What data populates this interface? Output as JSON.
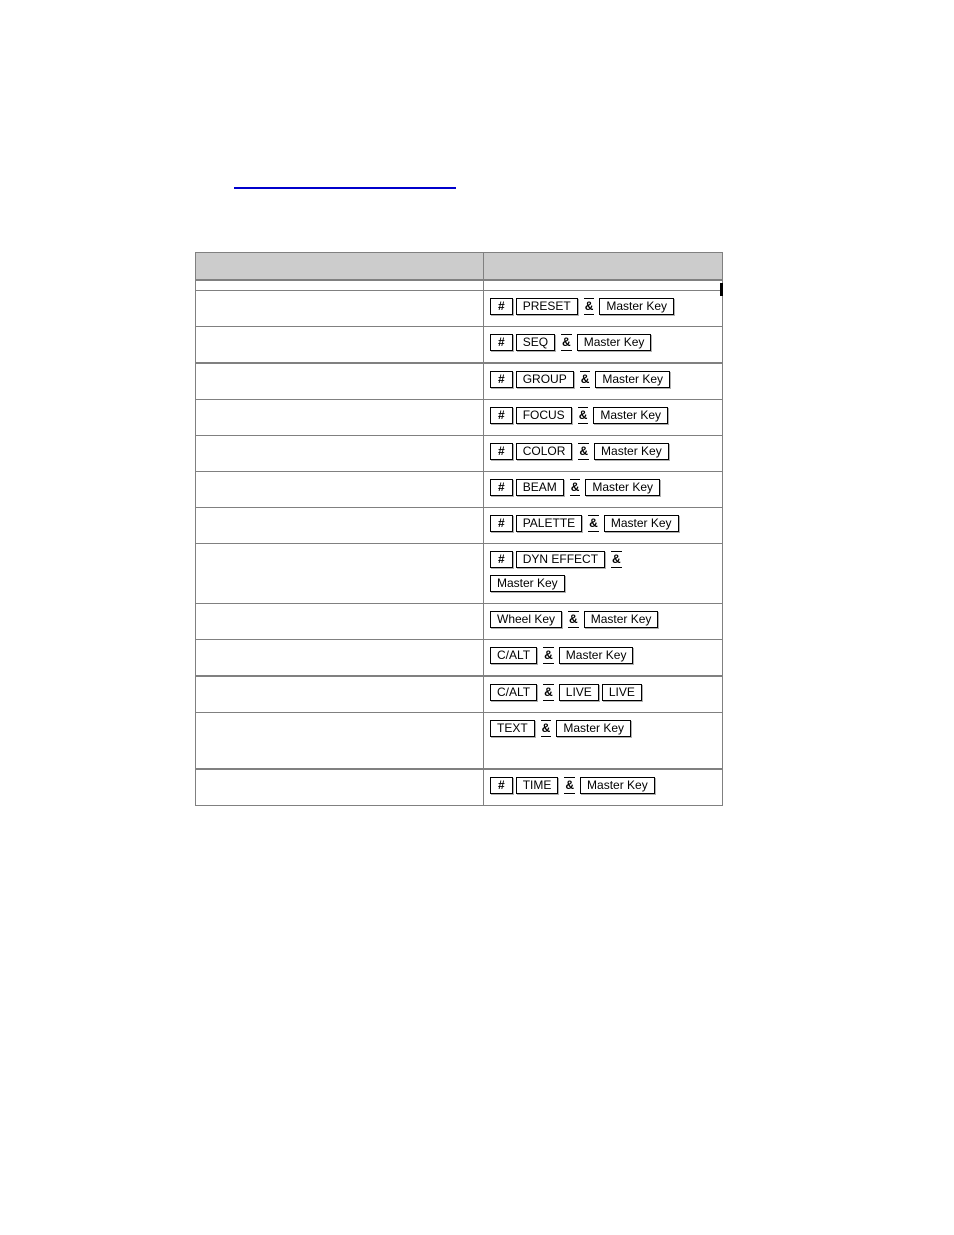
{
  "page": {
    "background_color": "#ffffff",
    "link_color": "#0000cc",
    "header_fill": "#cccccc",
    "border_color": "#808080"
  },
  "top_link": {
    "text": "",
    "name": "top-hyperlink"
  },
  "table": {
    "header": {
      "left_label": "",
      "right_label": ""
    },
    "spacer": {
      "left_label": "",
      "right_label": ""
    },
    "rows": [
      {
        "description": "",
        "thick_top": false,
        "extra_space": false,
        "tokens": [
          {
            "type": "key",
            "label": "#",
            "hash": true
          },
          {
            "type": "key",
            "label": "PRESET",
            "hash": false
          },
          {
            "type": "amp",
            "label": "&"
          },
          {
            "type": "key",
            "label": "Master Key",
            "hash": false
          }
        ]
      },
      {
        "description": "",
        "thick_top": false,
        "extra_space": false,
        "tokens": [
          {
            "type": "key",
            "label": "#",
            "hash": true
          },
          {
            "type": "key",
            "label": "SEQ",
            "hash": false
          },
          {
            "type": "amp",
            "label": "&"
          },
          {
            "type": "key",
            "label": "Master Key",
            "hash": false
          }
        ]
      },
      {
        "description": "",
        "thick_top": true,
        "extra_space": false,
        "tokens": [
          {
            "type": "key",
            "label": "#",
            "hash": true
          },
          {
            "type": "key",
            "label": "GROUP",
            "hash": false
          },
          {
            "type": "amp",
            "label": "&"
          },
          {
            "type": "key",
            "label": "Master Key",
            "hash": false
          }
        ]
      },
      {
        "description": "",
        "thick_top": false,
        "extra_space": false,
        "tokens": [
          {
            "type": "key",
            "label": "#",
            "hash": true
          },
          {
            "type": "key",
            "label": "FOCUS",
            "hash": false
          },
          {
            "type": "amp",
            "label": "&"
          },
          {
            "type": "key",
            "label": "Master Key",
            "hash": false
          }
        ]
      },
      {
        "description": "",
        "thick_top": false,
        "extra_space": false,
        "tokens": [
          {
            "type": "key",
            "label": "#",
            "hash": true
          },
          {
            "type": "key",
            "label": "COLOR",
            "hash": false
          },
          {
            "type": "amp",
            "label": "&"
          },
          {
            "type": "key",
            "label": "Master Key",
            "hash": false
          }
        ]
      },
      {
        "description": "",
        "thick_top": false,
        "extra_space": false,
        "tokens": [
          {
            "type": "key",
            "label": "#",
            "hash": true
          },
          {
            "type": "key",
            "label": "BEAM",
            "hash": false
          },
          {
            "type": "amp",
            "label": "&"
          },
          {
            "type": "key",
            "label": "Master Key",
            "hash": false
          }
        ]
      },
      {
        "description": "",
        "thick_top": false,
        "extra_space": false,
        "tokens": [
          {
            "type": "key",
            "label": "#",
            "hash": true
          },
          {
            "type": "key",
            "label": "PALETTE",
            "hash": false
          },
          {
            "type": "amp",
            "label": "&"
          },
          {
            "type": "key",
            "label": "Master Key",
            "hash": false
          }
        ]
      },
      {
        "description": "",
        "thick_top": false,
        "extra_space": false,
        "tokens": [
          {
            "type": "key",
            "label": "#",
            "hash": true
          },
          {
            "type": "key",
            "label": "DYN EFFECT",
            "hash": false
          },
          {
            "type": "amp",
            "label": "&"
          },
          {
            "type": "break"
          },
          {
            "type": "key",
            "label": "Master Key",
            "hash": false
          }
        ]
      },
      {
        "description": "",
        "thick_top": false,
        "extra_space": false,
        "tokens": [
          {
            "type": "key",
            "label": "Wheel Key",
            "hash": false
          },
          {
            "type": "amp",
            "label": "&"
          },
          {
            "type": "key",
            "label": "Master Key",
            "hash": false
          }
        ]
      },
      {
        "description": "",
        "thick_top": false,
        "extra_space": false,
        "tokens": [
          {
            "type": "key",
            "label": "C/ALT",
            "hash": false
          },
          {
            "type": "amp",
            "label": "&"
          },
          {
            "type": "key",
            "label": "Master Key",
            "hash": false
          }
        ]
      },
      {
        "description": "",
        "thick_top": true,
        "extra_space": false,
        "tokens": [
          {
            "type": "key",
            "label": "C/ALT",
            "hash": false
          },
          {
            "type": "amp",
            "label": "&"
          },
          {
            "type": "key",
            "label": "LIVE",
            "hash": false
          },
          {
            "type": "key",
            "label": "LIVE",
            "hash": false
          }
        ]
      },
      {
        "description": "",
        "thick_top": false,
        "extra_space": true,
        "tokens": [
          {
            "type": "key",
            "label": "TEXT",
            "hash": false
          },
          {
            "type": "amp",
            "label": "&"
          },
          {
            "type": "key",
            "label": "Master Key",
            "hash": false
          }
        ]
      },
      {
        "description": "",
        "thick_top": true,
        "extra_space": false,
        "tokens": [
          {
            "type": "key",
            "label": "#",
            "hash": true
          },
          {
            "type": "key",
            "label": "TIME",
            "hash": false
          },
          {
            "type": "amp",
            "label": "&"
          },
          {
            "type": "key",
            "label": "Master Key",
            "hash": false
          }
        ]
      }
    ]
  }
}
